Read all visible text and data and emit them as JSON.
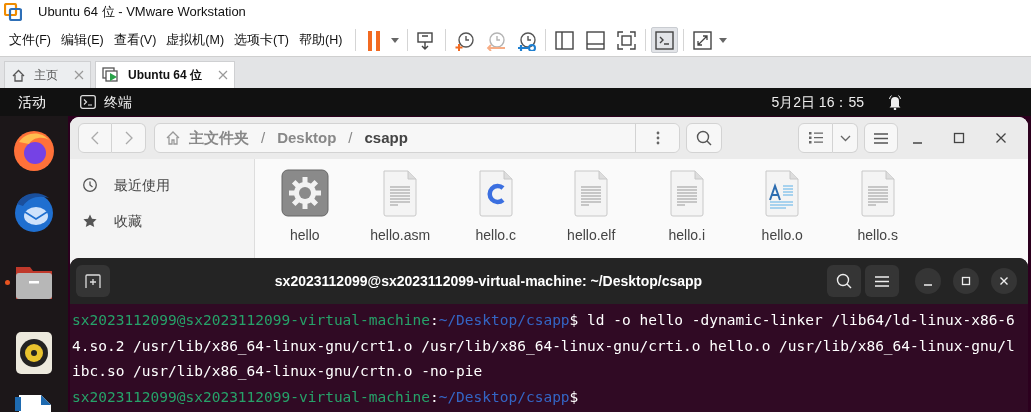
{
  "window": {
    "title": "Ubuntu 64 位 - VMware Workstation"
  },
  "menu": [
    "文件(F)",
    "编辑(E)",
    "查看(V)",
    "虚拟机(M)",
    "选项卡(T)",
    "帮助(H)"
  ],
  "toolbar": [
    {
      "items": [
        {
          "kind": "pause",
          "menu": true,
          "pressed": false,
          "disabled": false
        }
      ]
    },
    {
      "items": [
        {
          "kind": "send-keys",
          "menu": false,
          "pressed": false,
          "disabled": false
        }
      ]
    },
    {
      "items": [
        {
          "kind": "snapshot-take",
          "menu": false,
          "pressed": false,
          "disabled": false
        },
        {
          "kind": "snapshot-revert",
          "menu": false,
          "pressed": false,
          "disabled": true
        },
        {
          "kind": "snapshot-manager",
          "menu": false,
          "pressed": false,
          "disabled": false
        }
      ]
    },
    {
      "items": [
        {
          "kind": "view-sidebar",
          "menu": false,
          "pressed": false,
          "disabled": false
        },
        {
          "kind": "view-bottom",
          "menu": false,
          "pressed": false,
          "disabled": false
        },
        {
          "kind": "view-fit",
          "menu": false,
          "pressed": false,
          "disabled": false
        }
      ]
    },
    {
      "items": [
        {
          "kind": "console",
          "menu": false,
          "pressed": true,
          "disabled": false
        }
      ]
    },
    {
      "items": [
        {
          "kind": "fullscreen",
          "menu": true,
          "pressed": false,
          "disabled": false
        }
      ]
    }
  ],
  "tabs": [
    {
      "label": "主页",
      "kind": "home",
      "selected": false
    },
    {
      "label": "Ubuntu 64 位",
      "kind": "vm",
      "selected": true
    }
  ],
  "guest_top_bar": {
    "activities": "活动",
    "app": "终端",
    "clock": "5月2日 16：55"
  },
  "dock": [
    {
      "kind": "browser",
      "running": false
    },
    {
      "kind": "mail",
      "running": false
    },
    {
      "kind": "folder",
      "running": true
    },
    {
      "kind": "speaker",
      "running": false
    },
    {
      "kind": "document"
    }
  ],
  "file_manager": {
    "path": [
      {
        "label": "主文件夹",
        "kind": "home",
        "current": false
      },
      {
        "label": "Desktop",
        "kind": "folder",
        "current": false,
        "separator": "/"
      },
      {
        "label": "csapp",
        "kind": "folder",
        "current": true,
        "separator": "/"
      }
    ],
    "sidebar": [
      {
        "label": "最近使用",
        "kind": "recent"
      },
      {
        "label": "收藏",
        "kind": "starred"
      }
    ],
    "files": [
      {
        "name": "hello",
        "kind": "executable"
      },
      {
        "name": "hello.asm",
        "kind": "text"
      },
      {
        "name": "hello.c",
        "kind": "c"
      },
      {
        "name": "hello.elf",
        "kind": "text"
      },
      {
        "name": "hello.i",
        "kind": "text"
      },
      {
        "name": "hello.o",
        "kind": "document"
      },
      {
        "name": "hello.s",
        "kind": "text"
      }
    ]
  },
  "terminal": {
    "title": "sx2023112099@sx2023112099-virtual-machine: ~/Desktop/csapp",
    "lines": [
      {
        "segments": [
          {
            "kind": "user",
            "text": "sx2023112099@sx2023112099-virtual-machine"
          },
          {
            "kind": "plain",
            "text": ":"
          },
          {
            "kind": "path",
            "text": "~/Desktop/csapp"
          },
          {
            "kind": "plain",
            "text": "$ ld -o hello -dynamic-linker /lib64/ld-linux-x86-6"
          }
        ]
      },
      {
        "segments": [
          {
            "kind": "plain",
            "text": "4.so.2 /usr/lib/x86_64-linux-gnu/crt1.o /usr/lib/x86_64-linux-gnu/crti.o hello.o /usr/lib/x86_64-linux-gnu/l"
          }
        ]
      },
      {
        "segments": [
          {
            "kind": "plain",
            "text": "ibc.so /usr/lib/x86_64-linux-gnu/crtn.o -no-pie"
          }
        ]
      },
      {
        "segments": [
          {
            "kind": "user",
            "text": "sx2023112099@sx2023112099-virtual-machine"
          },
          {
            "kind": "plain",
            "text": ":"
          },
          {
            "kind": "path",
            "text": "~/Desktop/csapp"
          },
          {
            "kind": "plain",
            "text": "$"
          }
        ]
      }
    ]
  }
}
